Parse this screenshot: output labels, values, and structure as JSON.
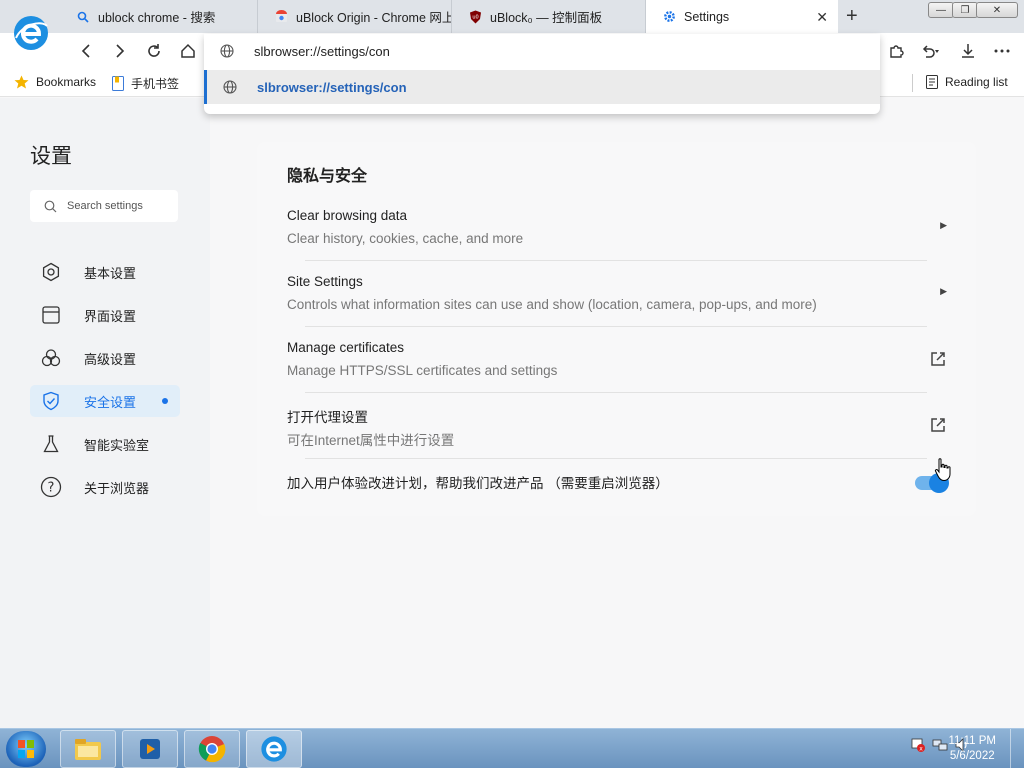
{
  "tabs": [
    {
      "label": "ublock chrome - 搜索",
      "icon": "search-icon"
    },
    {
      "label": "uBlock Origin - Chrome 网上",
      "icon": "chrome-store-icon"
    },
    {
      "label": "uBlock₀ — 控制面板",
      "icon": "ublock-shield-icon"
    },
    {
      "label": "Settings",
      "icon": "gear-icon",
      "active": true
    }
  ],
  "tab_close": "✕",
  "new_tab": "+",
  "window_controls": {
    "minimize": "—",
    "restore": "❐",
    "close": "✕"
  },
  "omnibox": {
    "value": "slbrowser://settings/con",
    "suggestion": "slbrowser://settings/con"
  },
  "bookmarks_bar": {
    "items": [
      {
        "label": "Bookmarks",
        "icon": "star-icon"
      },
      {
        "label": "手机书签",
        "icon": "bookmark-folder-icon"
      }
    ],
    "reading_list": "Reading list"
  },
  "sidebar": {
    "title": "设置",
    "search_placeholder": "Search settings",
    "items": [
      {
        "label": "基本设置",
        "icon": "gear-icon"
      },
      {
        "label": "界面设置",
        "icon": "window-icon"
      },
      {
        "label": "高级设置",
        "icon": "advanced-icon"
      },
      {
        "label": "安全设置",
        "icon": "shield-icon",
        "active": true
      },
      {
        "label": "智能实验室",
        "icon": "flask-icon"
      },
      {
        "label": "关于浏览器",
        "icon": "help-icon"
      }
    ]
  },
  "main": {
    "section_title": "隐私与安全",
    "rows": [
      {
        "title": "Clear browsing data",
        "subtitle": "Clear history, cookies, cache, and more",
        "action": "arrow"
      },
      {
        "title": "Site Settings",
        "subtitle": "Controls what information sites can use and show (location, camera, pop-ups, and more)",
        "action": "arrow"
      },
      {
        "title": "Manage certificates",
        "subtitle": "Manage HTTPS/SSL certificates and settings",
        "action": "external"
      },
      {
        "title": "打开代理设置",
        "subtitle": "可在Internet属性中进行设置",
        "action": "external"
      }
    ],
    "toggle_label": "加入用户体验改进计划，帮助我们改进产品 （需要重启浏览器）",
    "toggle_on": true
  },
  "taskbar": {
    "time": "11:11 PM",
    "date": "5/6/2022"
  },
  "colors": {
    "accent": "#1a73e8",
    "sidebar_bg": "#f2f3f5",
    "active_nav_bg": "#e1eef9"
  }
}
